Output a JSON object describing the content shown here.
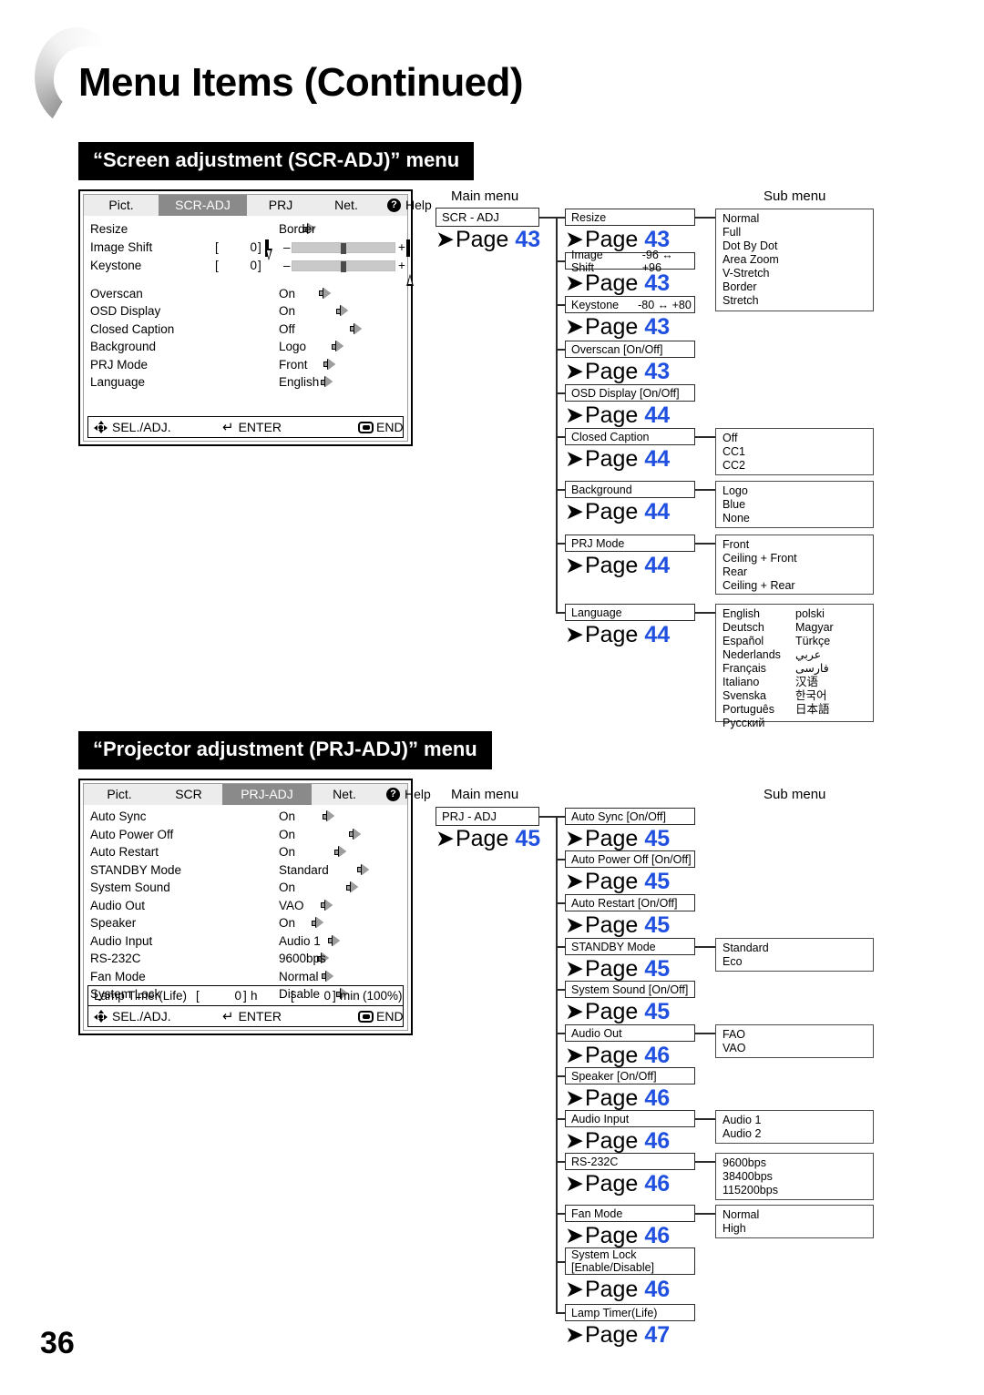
{
  "header": {
    "title": "Menu Items (Continued)",
    "folio": "36"
  },
  "accent_colors": {
    "page_number_blue": "#2050e0",
    "banner_background": "#000000",
    "osd_tab_active": "#8a8a8a",
    "osd_tab_bar": "#ececec"
  },
  "sections": [
    {
      "banner": "“Screen adjustment (SCR-ADJ)” menu",
      "osd": {
        "tabs": [
          {
            "label": "Pict.",
            "active": false
          },
          {
            "label": "SCR-ADJ",
            "active": true
          },
          {
            "label": "PRJ",
            "active": false
          },
          {
            "label": "Net.",
            "active": false
          },
          {
            "label": "Help",
            "active": false,
            "icon": "help-question-icon"
          }
        ],
        "rows": [
          {
            "label": "Resize",
            "value": "Border",
            "type": "arrow"
          },
          {
            "label": "Image Shift",
            "value": "0",
            "type": "slider",
            "minus": "–",
            "plus": "+",
            "bracket_open": "[",
            "bracket_close": "]"
          },
          {
            "label": "Keystone",
            "value": "0",
            "type": "slider",
            "minus": "–",
            "plus": "+",
            "bracket_open": "[",
            "bracket_close": "]"
          },
          {
            "label": "Overscan",
            "value": "On",
            "type": "arrow"
          },
          {
            "label": "OSD Display",
            "value": "On",
            "type": "arrow"
          },
          {
            "label": "Closed Caption",
            "value": "Off",
            "type": "arrow"
          },
          {
            "label": "Background",
            "value": "Logo",
            "type": "arrow"
          },
          {
            "label": "PRJ Mode",
            "value": "Front",
            "type": "arrow"
          },
          {
            "label": "Language",
            "value": "English",
            "type": "arrow"
          }
        ],
        "footer": {
          "sel": "SEL./ADJ.",
          "enter": "ENTER",
          "end": "END"
        }
      },
      "flow": {
        "col_main_label": "Main menu",
        "col_sub_label": "Sub menu",
        "main": {
          "label": "SCR - ADJ",
          "page_label": "Page",
          "page": "43"
        },
        "items": [
          {
            "label": "Resize",
            "page_label": "Page",
            "page": "43",
            "sub": [
              "Normal",
              "Full",
              "Dot By Dot",
              "Area Zoom",
              "V-Stretch",
              "Border",
              "Stretch"
            ]
          },
          {
            "label": "Image Shift",
            "range": "-96 ↔ +96",
            "page_label": "Page",
            "page": "43",
            "sub": []
          },
          {
            "label": "Keystone",
            "range": "-80 ↔ +80",
            "page_label": "Page",
            "page": "43",
            "sub": []
          },
          {
            "label": "Overscan [On/Off]",
            "page_label": "Page",
            "page": "43",
            "sub": []
          },
          {
            "label": "OSD Display [On/Off]",
            "page_label": "Page",
            "page": "44",
            "sub": []
          },
          {
            "label": "Closed Caption",
            "page_label": "Page",
            "page": "44",
            "sub": [
              "Off",
              "CC1",
              "CC2"
            ]
          },
          {
            "label": "Background",
            "page_label": "Page",
            "page": "44",
            "sub": [
              "Logo",
              "Blue",
              "None"
            ]
          },
          {
            "label": "PRJ Mode",
            "page_label": "Page",
            "page": "44",
            "sub": [
              "Front",
              "Ceiling + Front",
              "Rear",
              "Ceiling + Rear"
            ]
          },
          {
            "label": "Language",
            "page_label": "Page",
            "page": "44",
            "sub_col1": [
              "English",
              "Deutsch",
              "Español",
              "Nederlands",
              "Français",
              "Italiano",
              "Svenska",
              "Português",
              "Русский"
            ],
            "sub_col2": [
              "polski",
              "Magyar",
              "Türkçe",
              "عربي",
              "فارسی",
              "汉语",
              "한국어",
              "日本語"
            ]
          }
        ]
      }
    },
    {
      "banner": "“Projector adjustment (PRJ-ADJ)” menu",
      "osd": {
        "tabs": [
          {
            "label": "Pict.",
            "active": false
          },
          {
            "label": "SCR",
            "active": false
          },
          {
            "label": "PRJ-ADJ",
            "active": true
          },
          {
            "label": "Net.",
            "active": false
          },
          {
            "label": "Help",
            "active": false,
            "icon": "help-question-icon"
          }
        ],
        "rows": [
          {
            "label": "Auto Sync",
            "value": "On",
            "type": "arrow"
          },
          {
            "label": "Auto Power Off",
            "value": "On",
            "type": "arrow"
          },
          {
            "label": "Auto Restart",
            "value": "On",
            "type": "arrow"
          },
          {
            "label": "STANDBY Mode",
            "value": "Standard",
            "type": "arrow"
          },
          {
            "label": "System Sound",
            "value": "On",
            "type": "arrow"
          },
          {
            "label": "Audio Out",
            "value": "VAO",
            "type": "arrow"
          },
          {
            "label": "Speaker",
            "value": "On",
            "type": "arrow"
          },
          {
            "label": "Audio Input",
            "value": "Audio 1",
            "type": "arrow"
          },
          {
            "label": "RS-232C",
            "value": "9600bps",
            "type": "arrow"
          },
          {
            "label": "Fan Mode",
            "value": "Normal",
            "type": "arrow"
          },
          {
            "label": "System Lock",
            "value": "Disable",
            "type": "arrow"
          }
        ],
        "lamp_timer": {
          "label": "Lamp Timer(Life)",
          "hours": "0",
          "hours_unit": "h",
          "minutes": "0",
          "minutes_unit": "min",
          "percent": "(100%)"
        },
        "footer": {
          "sel": "SEL./ADJ.",
          "enter": "ENTER",
          "end": "END"
        }
      },
      "flow": {
        "col_main_label": "Main menu",
        "col_sub_label": "Sub menu",
        "main": {
          "label": "PRJ - ADJ",
          "page_label": "Page",
          "page": "45"
        },
        "items": [
          {
            "label": "Auto Sync [On/Off]",
            "page_label": "Page",
            "page": "45",
            "sub": []
          },
          {
            "label": "Auto Power Off [On/Off]",
            "page_label": "Page",
            "page": "45",
            "sub": []
          },
          {
            "label": "Auto Restart [On/Off]",
            "page_label": "Page",
            "page": "45",
            "sub": []
          },
          {
            "label": "STANDBY Mode",
            "page_label": "Page",
            "page": "45",
            "sub": [
              "Standard",
              "Eco"
            ]
          },
          {
            "label": "System Sound [On/Off]",
            "page_label": "Page",
            "page": "45",
            "sub": []
          },
          {
            "label": "Audio Out",
            "page_label": "Page",
            "page": "46",
            "sub": [
              "FAO",
              "VAO"
            ]
          },
          {
            "label": "Speaker [On/Off]",
            "page_label": "Page",
            "page": "46",
            "sub": []
          },
          {
            "label": "Audio Input",
            "page_label": "Page",
            "page": "46",
            "sub": [
              "Audio 1",
              "Audio 2"
            ]
          },
          {
            "label": "RS-232C",
            "page_label": "Page",
            "page": "46",
            "sub": [
              "9600bps",
              "38400bps",
              "115200bps"
            ]
          },
          {
            "label": "Fan Mode",
            "page_label": "Page",
            "page": "46",
            "sub": [
              "Normal",
              "High"
            ]
          },
          {
            "label": "System Lock",
            "label2": "[Enable/Disable]",
            "page_label": "Page",
            "page": "46",
            "sub": []
          },
          {
            "label": "Lamp Timer(Life)",
            "page_label": "Page",
            "page": "47",
            "sub": []
          }
        ]
      }
    }
  ]
}
